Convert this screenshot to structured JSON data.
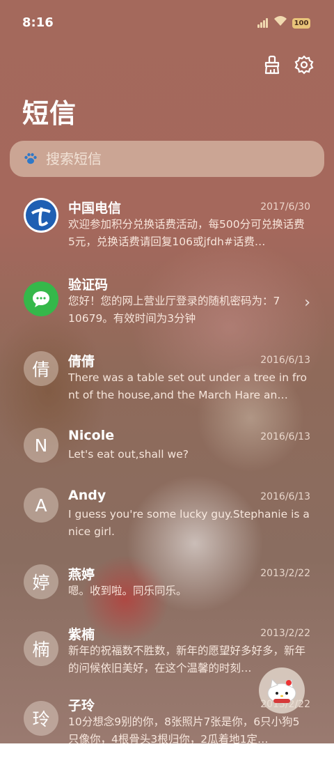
{
  "status_bar": {
    "time": "8:16",
    "battery": "100"
  },
  "header": {
    "title": "短信"
  },
  "search": {
    "placeholder": "搜索短信"
  },
  "conversations": [
    {
      "name": "中国电信",
      "date": "2017/6/30",
      "preview": "欢迎参加积分兑换话费活动，每500分可兑换话费5元，兑换话费请回复106或jfdh#话费…",
      "avatar": "telecom-logo-icon"
    },
    {
      "name": "验证码",
      "date": "",
      "preview": "您好！您的网上营业厅登录的随机密码为：710679。有效时间为3分钟",
      "avatar": "message-bubble-icon"
    },
    {
      "name": "倩倩",
      "date": "2016/6/13",
      "preview": "There was a table set out under a tree in front of the house,and the March Hare an…",
      "avatar_text": "倩"
    },
    {
      "name": "Nicole",
      "date": "2016/6/13",
      "preview": "Let's eat out,shall we?",
      "avatar_text": "N"
    },
    {
      "name": "Andy",
      "date": "2016/6/13",
      "preview": "I guess you're some lucky guy.Stephanie is a nice girl.",
      "avatar_text": "A"
    },
    {
      "name": "燕婷",
      "date": "2013/2/22",
      "preview": "嗯。收到啦。同乐同乐。",
      "avatar_text": "婷"
    },
    {
      "name": "紫楠",
      "date": "2013/2/22",
      "preview": "新年的祝福数不胜数，新年的愿望好多好多，新年的问候依旧美好，在这个温馨的时刻…",
      "avatar_text": "楠"
    },
    {
      "name": "子玲",
      "date": "2013/2/22",
      "preview": "10分想念9别的你，8张照片7张是你，6只小狗5只像你，4根骨头3根归你，2瓜着地1定…",
      "avatar_text": "玲"
    }
  ]
}
